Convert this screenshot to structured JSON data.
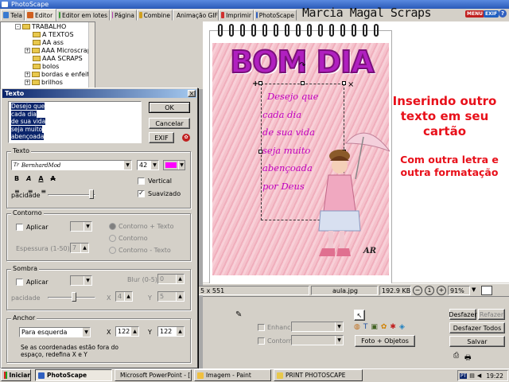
{
  "app": {
    "title": "PhotoScape"
  },
  "tabs": [
    {
      "label": "Tela",
      "color": "#3a7ad0"
    },
    {
      "label": "Editor",
      "color": "#d06020"
    },
    {
      "label": "Editor em lotes",
      "color": "#3a9a3a"
    },
    {
      "label": "Página",
      "color": "#b040b0"
    },
    {
      "label": "Combine",
      "color": "#d0a020"
    },
    {
      "label": "Animação GIF",
      "color": "#20a0a0"
    },
    {
      "label": "Imprimir",
      "color": "#d03030"
    },
    {
      "label": "PhotoScape",
      "color": "#3060c0"
    }
  ],
  "brand": {
    "text": "Marcia Magal Scraps",
    "menu_badge": "MENU",
    "exif_badge": "EXIF",
    "help_badge": "?"
  },
  "tree": {
    "items": [
      {
        "label": "TRABALHO",
        "expander": "-"
      },
      {
        "label": "A TEXTOS",
        "expander": ""
      },
      {
        "label": "AA ass",
        "expander": ""
      },
      {
        "label": "AAA Microscrap",
        "expander": "+"
      },
      {
        "label": "AAA SCRAPS",
        "expander": ""
      },
      {
        "label": "bolos",
        "expander": ""
      },
      {
        "label": "bordas e enfeit",
        "expander": "+"
      },
      {
        "label": "brilhos",
        "expander": "+"
      }
    ]
  },
  "dialog": {
    "title": "Texto",
    "close": "×",
    "text_lines": [
      "Desejo que",
      "cada dia",
      "de sua vida",
      "seja muito",
      "abençoada"
    ],
    "ok": "OK",
    "cancel": "Cancelar",
    "exif": "EXIF",
    "texto_group": "Texto",
    "font_name": "BernhardMod",
    "font_size": "42",
    "text_color": "#ff00ff",
    "style_buttons": [
      "B",
      "A",
      "A",
      "A"
    ],
    "vertical": "Vertical",
    "suavizado": "Suavizado",
    "opacidade": "pacidade",
    "contorno_group": "Contorno",
    "aplicar": "Aplicar",
    "contorno_opts": [
      "Contorno + Texto",
      "Contorno",
      "Contorno - Texto"
    ],
    "espessura": "Espessura (1-50)",
    "espessura_val": "7",
    "sombra_group": "Sombra",
    "blur_label": "Blur (0-5)",
    "blur_val": "0",
    "x_label": "X",
    "x_val": "4",
    "y_label": "Y",
    "y_val": "5",
    "anchor_group": "Anchor",
    "anchor_value": "Para esquerda",
    "anchor_x": "122",
    "anchor_y": "122",
    "note": "Se as coordenadas estão fora do espaço, redefina X e Y"
  },
  "canvas": {
    "title": "BOM DIA",
    "text_lines": [
      "Desejo que",
      "cada dia",
      "de sua vida",
      "seja muito",
      "abençoada",
      "por Deus"
    ],
    "signature": "AR"
  },
  "overlay": {
    "main": "Inserindo outro texto em seu cartão",
    "sub": "Com outra letra e outra formatação"
  },
  "status": {
    "dimensions": "5 x 551",
    "filename": "aula.jpg",
    "filesize": "192.9 KB",
    "zoom": "91%"
  },
  "bottom": {
    "enhancer": "Enhancer",
    "contorno": "Contorno",
    "foto_objetos": "Foto + Objetos",
    "desfazer": "Desfazer",
    "refazer": "Refazer",
    "desfazer_todos": "Desfazer Todos",
    "salvar": "Salvar"
  },
  "taskbar": {
    "start": "Iniciar",
    "items": [
      "PhotoScape",
      "Microsoft PowerPoint - [...",
      "Imagem - Paint",
      "PRINT PHOTOSCAPE"
    ],
    "clock": "19:22",
    "lang": "PT"
  }
}
